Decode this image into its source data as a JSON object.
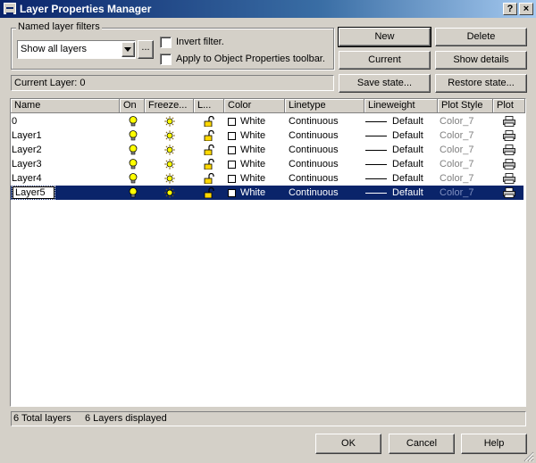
{
  "window": {
    "title": "Layer Properties Manager",
    "help_btn": "?",
    "close_btn": "×"
  },
  "filters": {
    "group_label": "Named layer filters",
    "selected": "Show all layers",
    "browse_label": "...",
    "invert_label": "Invert filter.",
    "apply_label": "Apply to Object Properties toolbar."
  },
  "buttons": {
    "new": "New",
    "delete": "Delete",
    "current": "Current",
    "show_details": "Show details",
    "save_state": "Save state...",
    "restore_state": "Restore state...",
    "ok": "OK",
    "cancel": "Cancel",
    "help": "Help"
  },
  "current_layer": "Current Layer:  0",
  "columns": [
    "Name",
    "On",
    "Freeze...",
    "L...",
    "Color",
    "Linetype",
    "Lineweight",
    "Plot Style",
    "Plot"
  ],
  "layers": [
    {
      "name": "0",
      "color": "White",
      "linetype": "Continuous",
      "lineweight": "Default",
      "plot_style": "Color_7"
    },
    {
      "name": "Layer1",
      "color": "White",
      "linetype": "Continuous",
      "lineweight": "Default",
      "plot_style": "Color_7"
    },
    {
      "name": "Layer2",
      "color": "White",
      "linetype": "Continuous",
      "lineweight": "Default",
      "plot_style": "Color_7"
    },
    {
      "name": "Layer3",
      "color": "White",
      "linetype": "Continuous",
      "lineweight": "Default",
      "plot_style": "Color_7"
    },
    {
      "name": "Layer4",
      "color": "White",
      "linetype": "Continuous",
      "lineweight": "Default",
      "plot_style": "Color_7"
    },
    {
      "name": "Layer5",
      "color": "White",
      "linetype": "Continuous",
      "lineweight": "Default",
      "plot_style": "Color_7",
      "selected": true,
      "editing": true
    }
  ],
  "status": {
    "total": "6 Total layers",
    "displayed": "6 Layers displayed"
  },
  "icons": {
    "on": "lightbulb-icon",
    "freeze": "sun-icon",
    "lock": "unlocked-padlock-icon",
    "plot": "printer-icon"
  },
  "colors": {
    "titlebar_start": "#0a246a",
    "titlebar_end": "#a6caf0",
    "selection": "#0a246a",
    "bulb": "#ffff00",
    "face": "#d4d0c8"
  }
}
